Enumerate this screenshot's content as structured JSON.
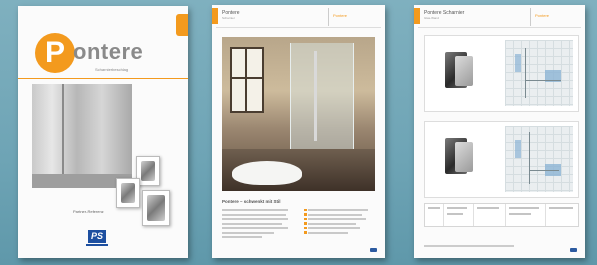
{
  "cover": {
    "brand_initial": "P",
    "brand_rest": "ontere",
    "subtitle": "Scharnierbeschlag",
    "caption": "Partner-Referenz",
    "partner_logo": "PS"
  },
  "page2": {
    "header_title": "Pontere",
    "header_subtitle": "Scharnier",
    "header_right": "Pontere",
    "body_title": "Pontere – schwenkt mit Stil"
  },
  "page3": {
    "header_title": "Pontere Scharnier",
    "header_subtitle": "Glas-Wand",
    "header_right": "Pontere"
  },
  "colors": {
    "accent": "#f39a1e",
    "background": "#6ea4b5",
    "partner_blue": "#1d4fa0"
  }
}
